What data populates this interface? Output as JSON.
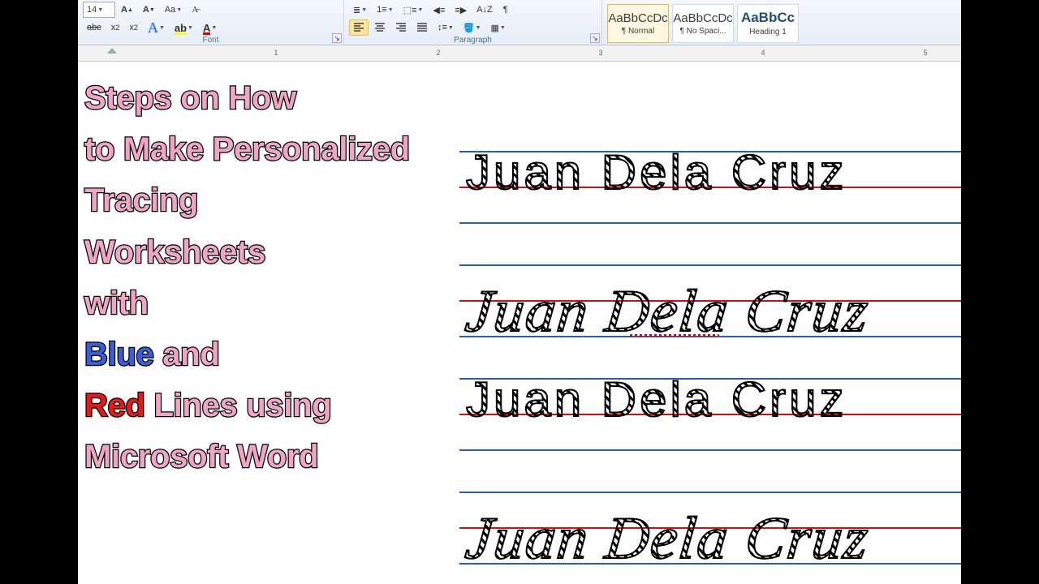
{
  "ribbon": {
    "font_size": "14",
    "font_group_label": "Font",
    "paragraph_group_label": "Paragraph",
    "styles": [
      {
        "preview": "AaBbCcDc",
        "name": "¶ Normal",
        "selected": true
      },
      {
        "preview": "AaBbCcDc",
        "name": "¶ No Spaci...",
        "selected": false
      },
      {
        "preview": "AaBbCc",
        "name": "Heading 1",
        "selected": false,
        "heading": true
      }
    ]
  },
  "ruler": {
    "numbers": [
      "1",
      "2",
      "3",
      "4",
      "5"
    ]
  },
  "title": {
    "lines": [
      [
        {
          "t": "Steps on How"
        }
      ],
      [
        {
          "t": "to Make Personalized"
        }
      ],
      [
        {
          "t": "Tracing"
        }
      ],
      [
        {
          "t": "Worksheets"
        }
      ],
      [
        {
          "t": "with"
        }
      ],
      [
        {
          "t": "Blue",
          "c": "blue"
        },
        {
          "t": " and"
        }
      ],
      [
        {
          "t": "Red",
          "c": "red"
        },
        {
          "t": " Lines using"
        }
      ],
      [
        {
          "t": "Microsoft Word"
        }
      ]
    ]
  },
  "tracing": {
    "name": "Juan Dela Cruz",
    "rows": [
      {
        "style": "print"
      },
      {
        "style": "cursive"
      },
      {
        "style": "print"
      },
      {
        "style": "cursive"
      }
    ]
  }
}
